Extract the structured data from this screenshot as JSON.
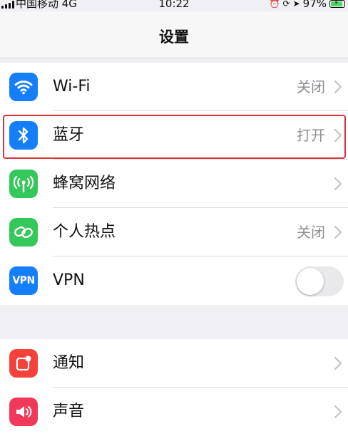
{
  "status_bar": {
    "carrier": "中国移动 4G",
    "time": "10:22",
    "battery": "97%"
  },
  "nav": {
    "title": "设置"
  },
  "groups": [
    {
      "items": [
        {
          "label": "Wi-Fi",
          "value": "关闭",
          "icon": "wifi-icon",
          "color": "#147efb"
        },
        {
          "label": "蓝牙",
          "value": "打开",
          "icon": "bluetooth-icon",
          "color": "#147efb"
        },
        {
          "label": "蜂窝网络",
          "value": "",
          "icon": "cellular-antenna-icon",
          "color": "#34c759"
        },
        {
          "label": "个人热点",
          "value": "关闭",
          "icon": "personal-hotspot-icon",
          "color": "#34c759"
        },
        {
          "label": "VPN",
          "value": "",
          "icon": "vpn-icon",
          "icon_text": "VPN",
          "color": "#147efb",
          "toggle_on": false
        }
      ]
    },
    {
      "items": [
        {
          "label": "通知",
          "value": "",
          "icon": "notifications-icon",
          "color": "#f4413c"
        },
        {
          "label": "声音",
          "value": "",
          "icon": "sound-speaker-icon",
          "color": "#f2385a"
        }
      ]
    }
  ],
  "colors": {
    "highlight": "#d8353b",
    "background": "#efeff4"
  }
}
